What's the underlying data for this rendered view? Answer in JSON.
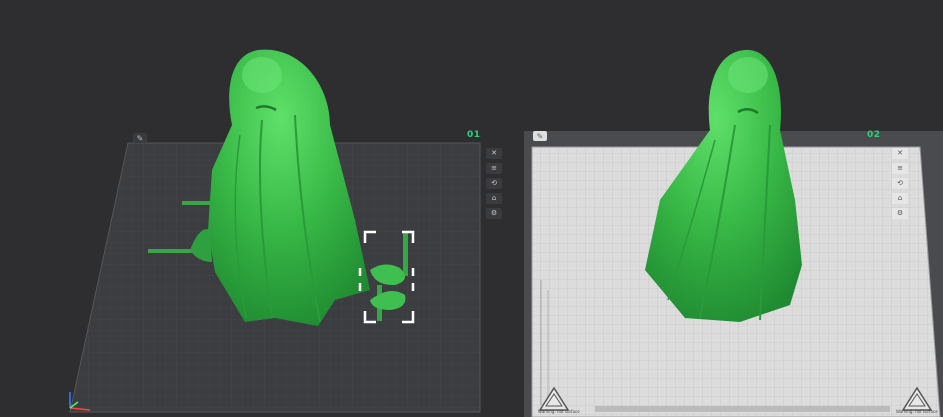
{
  "plates": [
    {
      "label": "01",
      "state": "dark"
    },
    {
      "label": "02",
      "state": "selected-light"
    }
  ],
  "plate_tools": [
    {
      "name": "close-icon",
      "glyph": "✕"
    },
    {
      "name": "arrange-icon",
      "glyph": "≡"
    },
    {
      "name": "orient-icon",
      "glyph": "⟲"
    },
    {
      "name": "lock-icon",
      "glyph": "⌂"
    },
    {
      "name": "settings-icon",
      "glyph": "⚙"
    }
  ],
  "warning_text": "Warning: hot surface",
  "colors": {
    "background": "#2e2e31",
    "model_green": "#3fbf4f",
    "accent": "#2fd07a",
    "light_plate": "#dcdcdc",
    "dark_plate": "#3c3d40"
  }
}
